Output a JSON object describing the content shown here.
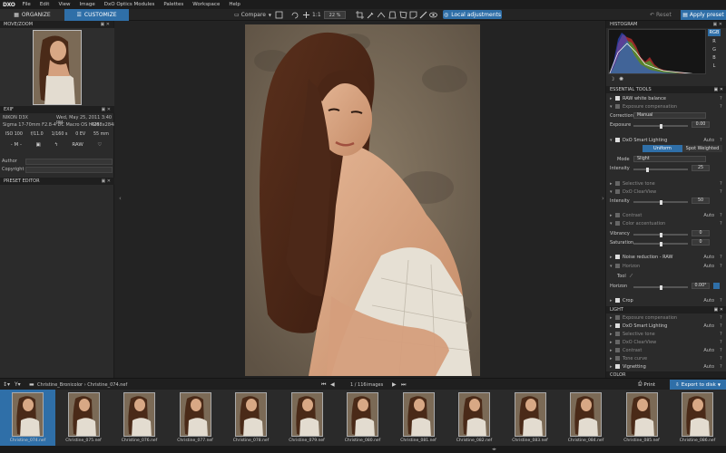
{
  "menubar": {
    "logo": "DXO",
    "items": [
      "File",
      "Edit",
      "View",
      "Image",
      "DxO Optics Modules",
      "Palettes",
      "Workspace",
      "Help"
    ]
  },
  "toolbar": {
    "organize": "ORGANIZE",
    "customize": "CUSTOMIZE",
    "compare": "Compare",
    "ratio": "1:1",
    "zoom": "22 %",
    "local_adjustments": "Local adjustments",
    "reset": "Reset",
    "apply_preset": "Apply preset"
  },
  "left": {
    "move_zoom": "MOVE/ZOOM",
    "exif": "EXIF",
    "camera": "NIKON D3X",
    "date": "Wed, May 25, 2011 3:40 PM",
    "lens": "Sigma 17-70mm F2.8-4 DC Macro OS HSM",
    "dims": "4288x2848",
    "stats": [
      "ISO 100",
      "f/11.0",
      "1/160 s",
      "0 EV",
      "55 mm"
    ],
    "mode": "- M -",
    "raw": "RAW",
    "author_label": "Author",
    "copyright_label": "Copyright",
    "preset_editor": "PRESET EDITOR"
  },
  "right": {
    "histogram": "HISTOGRAM",
    "channels": [
      "RGB",
      "R",
      "G",
      "B",
      "L"
    ],
    "essential_tools": "ESSENTIAL TOOLS",
    "raw_wb": "RAW white balance",
    "exp_comp": "Exposure compensation",
    "correction_label": "Correction",
    "correction_value": "Manual",
    "exposure_label": "Exposure",
    "exposure_value": "0.00",
    "smart_lighting": "DxO Smart Lighting",
    "auto": "Auto",
    "uniform": "Uniform",
    "spot_weighted": "Spot Weighted",
    "mode_label": "Mode",
    "mode_value": "Slight",
    "intensity_label": "Intensity",
    "intensity_value": "25",
    "selective_tone": "Selective tone",
    "clearview": "DxO ClearView",
    "clearview_intensity": "50",
    "contrast": "Contrast",
    "color_accent": "Color accentuation",
    "vibrancy_label": "Vibrancy",
    "vibrancy_value": "0",
    "saturation_label": "Saturation",
    "saturation_value": "0",
    "noise": "Noise reduction - RAW",
    "horizon": "Horizon",
    "tool_label": "Tool",
    "horizon_value": "0.00°",
    "crop": "Crop",
    "light": "LIGHT",
    "tone_curve": "Tone curve",
    "vignetting": "Vignetting",
    "color": "COLOR"
  },
  "filmbar": {
    "path": "Christine_Bronicolor › Christine_074.nef",
    "counter": "1 / 116",
    "images_label": "images",
    "print": "Print",
    "export": "Export to disk"
  },
  "film": [
    "Christine_074.nef",
    "Christine_075.nef",
    "Christine_076.nef",
    "Christine_077.nef",
    "Christine_078.nef",
    "Christine_079.nef",
    "Christine_080.nef",
    "Christine_081.nef",
    "Christine_082.nef",
    "Christine_083.nef",
    "Christine_084.nef",
    "Christine_085.nef",
    "Christine_086.nef"
  ],
  "colors": {
    "accent": "#2f6fa8",
    "panel": "#2b2b2b",
    "dark": "#1c1c1c"
  }
}
